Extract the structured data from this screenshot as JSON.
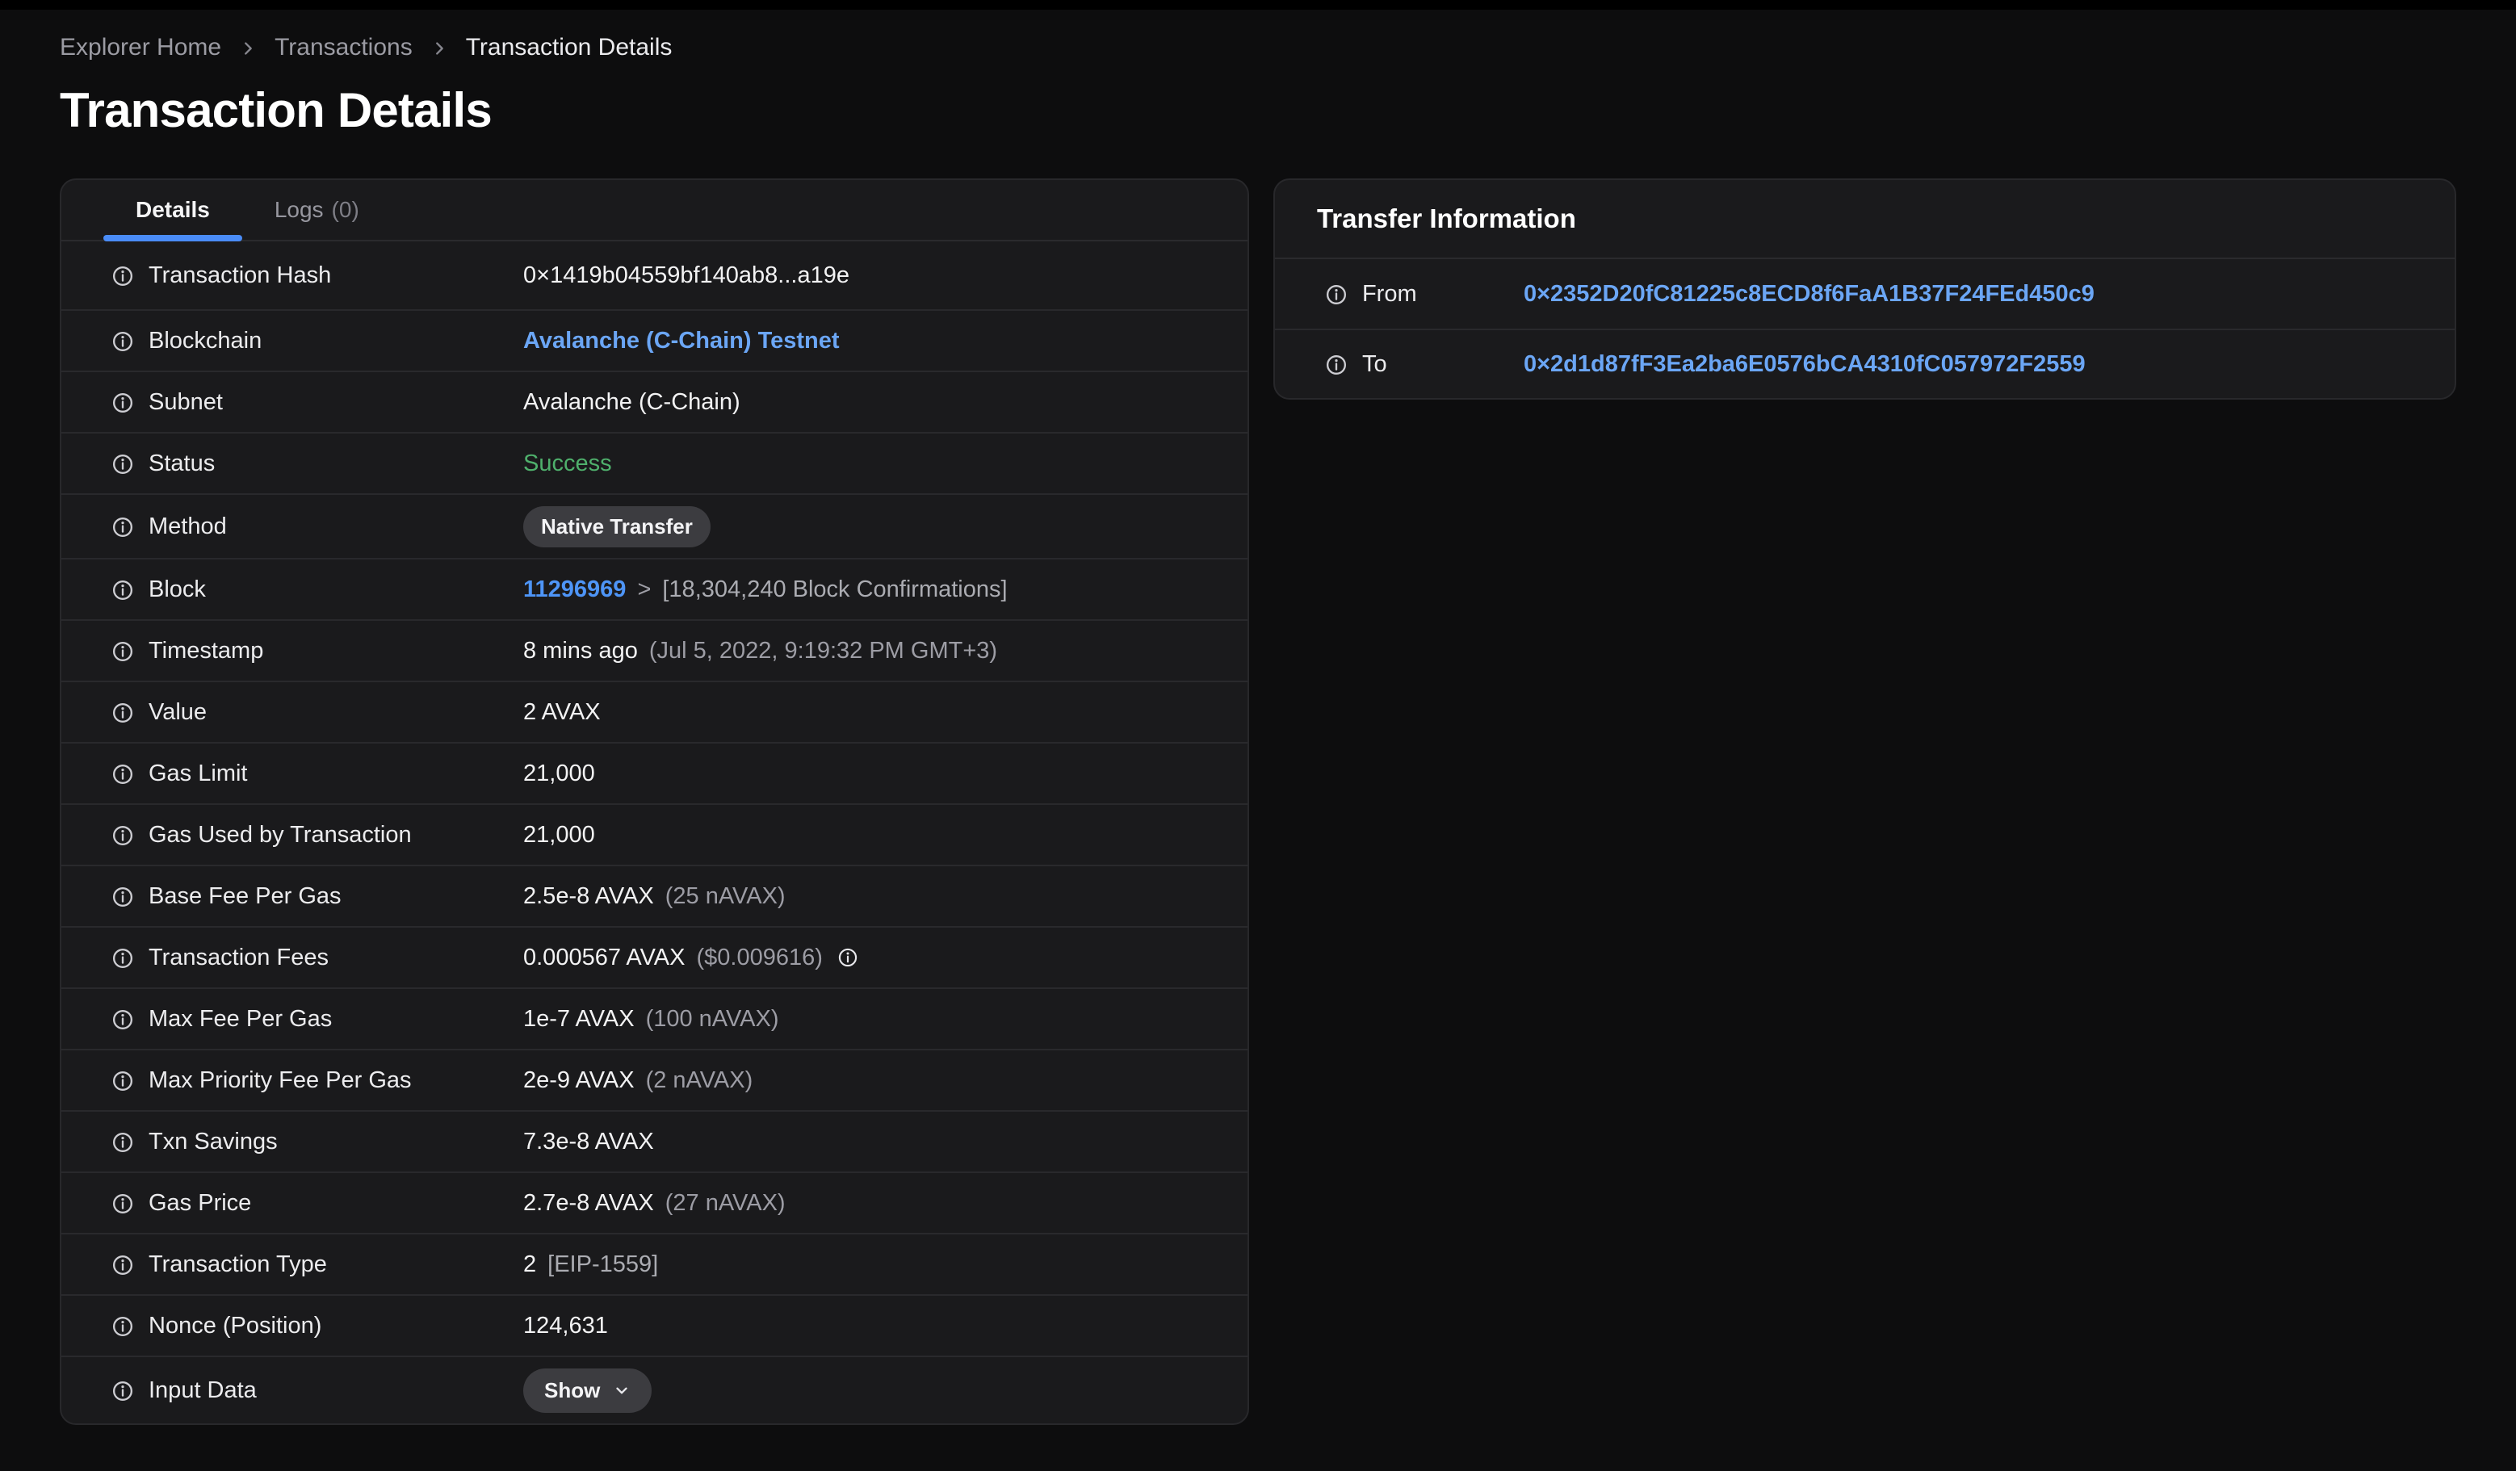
{
  "breadcrumb": {
    "items": [
      {
        "label": "Explorer Home"
      },
      {
        "label": "Transactions"
      },
      {
        "label": "Transaction Details"
      }
    ]
  },
  "page": {
    "title": "Transaction Details"
  },
  "icons": {
    "row_prefix": "info-circle",
    "breadcrumb_separator": "chevron-right",
    "show_button_suffix": "chevron-down",
    "fees_suffix": "info-circle"
  },
  "colors": {
    "accent_blue": "#4a8cf7",
    "link_blue": "#6ba6f5",
    "block_link_blue": "#4e95f7",
    "success_green": "#4fb06c",
    "card_background": "#1a1a1c",
    "page_background": "#0d0d0e"
  },
  "details_card": {
    "tabs": [
      {
        "label": "Details",
        "active": true
      },
      {
        "label": "Logs",
        "count": "(0)",
        "active": false
      }
    ],
    "rows": [
      {
        "label": "Transaction Hash",
        "value": "0×1419b04559bf140ab8...a19e"
      },
      {
        "label": "Blockchain",
        "link": "Avalanche (C-Chain) Testnet"
      },
      {
        "label": "Subnet",
        "value": "Avalanche (C-Chain)"
      },
      {
        "label": "Status",
        "status": "Success"
      },
      {
        "label": "Method",
        "badge": "Native Transfer"
      },
      {
        "label": "Block",
        "link": "11296969",
        "sep": ">",
        "secondary": "[18,304,240 Block Confirmations]"
      },
      {
        "label": "Timestamp",
        "value": "8 mins ago",
        "secondary": "(Jul 5, 2022, 9:19:32 PM GMT+3)"
      },
      {
        "label": "Value",
        "value": "2 AVAX"
      },
      {
        "label": "Gas Limit",
        "value": "21,000"
      },
      {
        "label": "Gas Used by Transaction",
        "value": "21,000"
      },
      {
        "label": "Base Fee Per Gas",
        "value": "2.5e-8 AVAX",
        "secondary": "(25 nAVAX)"
      },
      {
        "label": "Transaction Fees",
        "value": "0.000567 AVAX",
        "secondary": "($0.009616)"
      },
      {
        "label": "Max Fee Per Gas",
        "value": "1e-7 AVAX",
        "secondary": "(100 nAVAX)"
      },
      {
        "label": "Max Priority Fee Per Gas",
        "value": "2e-9 AVAX",
        "secondary": "(2 nAVAX)"
      },
      {
        "label": "Txn Savings",
        "value": "7.3e-8 AVAX"
      },
      {
        "label": "Gas Price",
        "value": "2.7e-8 AVAX",
        "secondary": "(27 nAVAX)"
      },
      {
        "label": "Transaction Type",
        "value": "2",
        "secondary": "[EIP-1559]"
      },
      {
        "label": "Nonce (Position)",
        "value": "124,631"
      },
      {
        "label": "Input Data",
        "button": "Show"
      }
    ]
  },
  "transfer_card": {
    "title": "Transfer Information",
    "rows": [
      {
        "label": "From",
        "link": "0×2352D20fC81225c8ECD8f6FaA1B37F24FEd450c9"
      },
      {
        "label": "To",
        "link": "0×2d1d87fF3Ea2ba6E0576bCA4310fC057972F2559"
      }
    ]
  }
}
